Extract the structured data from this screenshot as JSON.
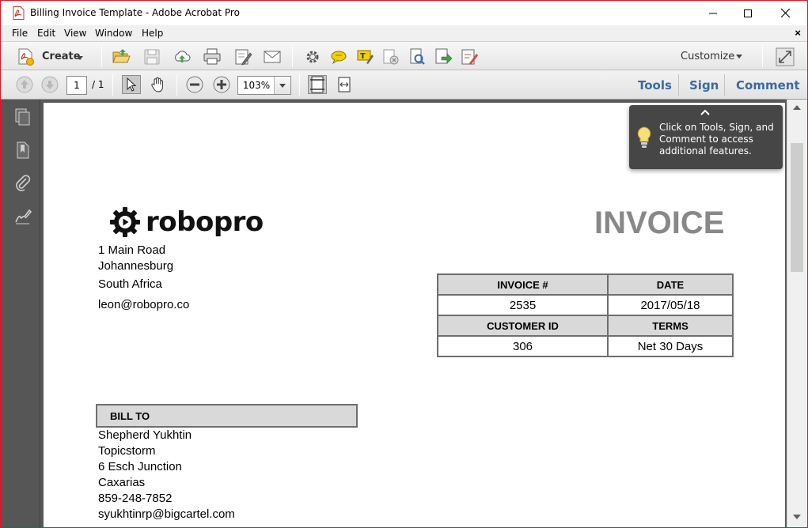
{
  "window": {
    "title": "Billing Invoice Template - Adobe Acrobat Pro"
  },
  "menu": {
    "items": [
      "File",
      "Edit",
      "View",
      "Window",
      "Help"
    ],
    "close_glyph": "×"
  },
  "toolbar": {
    "create_label": "Create",
    "customize_label": "Customize",
    "icons": [
      "create-pdf-icon",
      "open-icon",
      "save-icon",
      "upload-icon",
      "print-icon",
      "edit-icon",
      "email-icon",
      "settings-icon",
      "comment-icon",
      "highlight-icon",
      "combine-icon",
      "scan-icon",
      "export-icon",
      "fill-sign-icon",
      "expand-icon"
    ]
  },
  "navigation": {
    "current_page": "1",
    "total_pages": "/ 1",
    "zoom": "103%",
    "links": [
      "Tools",
      "Sign",
      "Comment"
    ]
  },
  "tip": {
    "text": "Click on Tools, Sign, and Comment to access additional features."
  },
  "invoice": {
    "logo_text": "robopro",
    "title": "INVOICE",
    "sender": {
      "line1": "1 Main Road",
      "line2": "Johannesburg",
      "line3": "South Africa",
      "email": "leon@robopro.co"
    },
    "meta": {
      "invoice_no_label": "INVOICE #",
      "date_label": "DATE",
      "invoice_no": "2535",
      "date": "2017/05/18",
      "customer_id_label": "CUSTOMER ID",
      "terms_label": "TERMS",
      "customer_id": "306",
      "terms": "Net 30 Days"
    },
    "bill_to": {
      "label": "BILL TO",
      "name": "Shepherd Yukhtin",
      "company": "Topicstorm",
      "street": "6 Esch Junction",
      "city": "Caxarias",
      "phone": "859-248-7852",
      "email": "syukhtinrp@bigcartel.com"
    }
  },
  "colors": {
    "accent_link": "#3b6aa0",
    "window_border": "#e81123",
    "invoice_title": "#888888",
    "table_header_bg": "#d9d9d9"
  }
}
